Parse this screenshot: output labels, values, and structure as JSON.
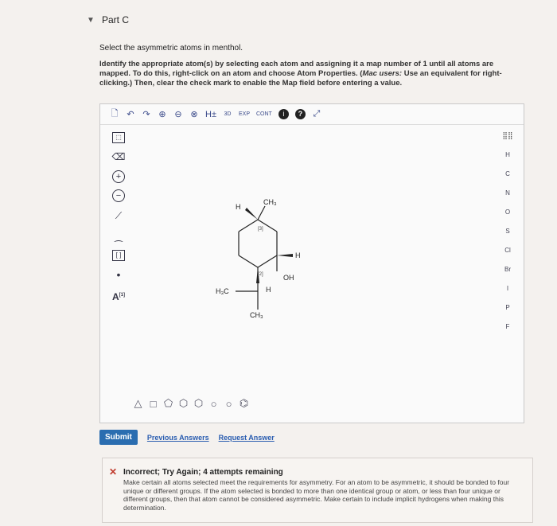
{
  "part": {
    "title": "Part C",
    "caret": "▼"
  },
  "question": {
    "prompt": "Select the asymmetric atoms in menthol.",
    "instructions_main": "Identify the appropriate atom(s) by selecting each atom and assigning it a map number of 1 until all atoms are mapped. To do this, right-click on an atom and choose Atom Properties. (",
    "instructions_mac_label": "Mac users:",
    "instructions_rest": " Use an equivalent for right-clicking.) Then, clear the check mark to enable the Map field before entering a value."
  },
  "toolbar": {
    "new": "🗋",
    "undo": "↶",
    "redo": "↷",
    "zoom_in": "⊕",
    "zoom_out": "⊖",
    "clear": "⊗",
    "h_toggle": "H±",
    "view_3d": "3D",
    "exp": "EXP",
    "cont": "CONT",
    "info": "i",
    "help": "?",
    "fullscreen": "⤢"
  },
  "left_tools": [
    "⬚",
    "⌫",
    "+",
    "−",
    "⟋",
    "⁔",
    "[ ]",
    "•",
    "A"
  ],
  "left_tools_sup": "[1]",
  "periodic_icon": "⣿⣿",
  "elements": [
    "H",
    "C",
    "N",
    "O",
    "S",
    "Cl",
    "Br",
    "I",
    "P",
    "F"
  ],
  "shapes": [
    "△",
    "□",
    "⬠",
    "⬡",
    "⬡",
    "○",
    "○",
    "⌬"
  ],
  "molecule": {
    "h_top": "H",
    "ch3_top": "CH₃",
    "map_top": "[3]",
    "h_right": "H",
    "oh": "OH",
    "map_bottom": "[2]",
    "h_bottom": "H",
    "h3c": "H₃C",
    "ch3_bottom": "CH₃"
  },
  "actions": {
    "submit": "Submit",
    "previous": "Previous Answers",
    "request": "Request Answer"
  },
  "feedback": {
    "icon": "✕",
    "title": "Incorrect; Try Again; 4 attempts remaining",
    "text": "Make certain all atoms selected meet the requirements for asymmetry. For an atom to be asymmetric, it should be bonded to four unique or different groups. If the atom selected is bonded to more than one identical group or atom, or less than four unique or different groups, then that atom cannot be considered asymmetric. Make certain to include implicit hydrogens when making this determination."
  }
}
